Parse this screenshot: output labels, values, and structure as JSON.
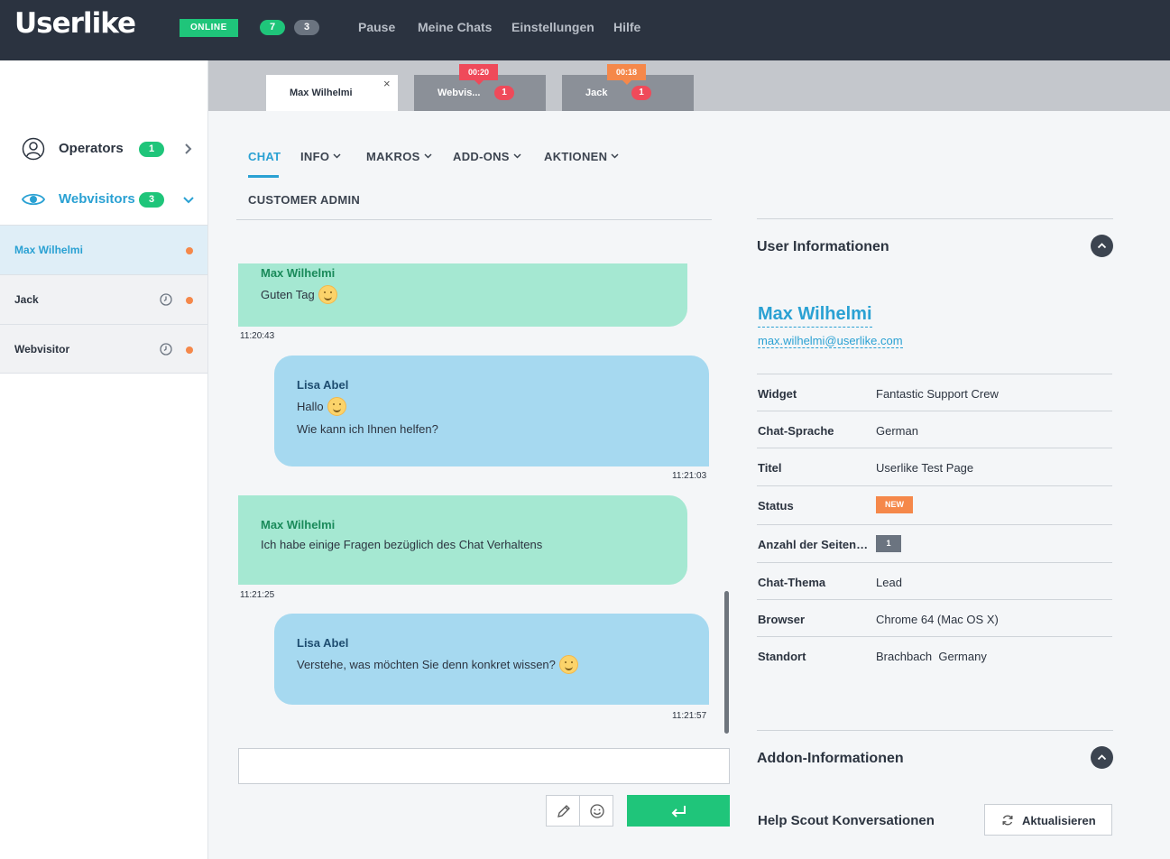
{
  "topbar": {
    "logo": "Userlike",
    "status": "ONLINE",
    "count_active": "7",
    "count_waiting": "3",
    "nav": [
      "Pause",
      "Meine Chats",
      "Einstellungen",
      "Hilfe"
    ]
  },
  "sidebar": {
    "operators": {
      "label": "Operators",
      "count": "1"
    },
    "webvisitors": {
      "label": "Webvisitors",
      "count": "3"
    },
    "visitors": [
      {
        "name": "Max Wilhelmi"
      },
      {
        "name": "Jack"
      },
      {
        "name": "Webvisitor"
      }
    ]
  },
  "tabs": [
    {
      "label": "Max Wilhelmi",
      "close": "×"
    },
    {
      "label": "Webvis...",
      "count": "1",
      "timer": "00:20"
    },
    {
      "label": "Jack",
      "count": "1",
      "timer": "00:18"
    }
  ],
  "chatnav": {
    "chat": "CHAT",
    "info": "INFO",
    "makros": "MAKROS",
    "addons": "ADD-ONS",
    "aktionen": "AKTIONEN",
    "customer_admin": "CUSTOMER ADMIN"
  },
  "messages": [
    {
      "sender": "Max Wilhelmi",
      "text": "Guten Tag",
      "time": "11:20:43"
    },
    {
      "sender": "Lisa Abel",
      "line1": "Hallo",
      "line2": "Wie kann ich Ihnen helfen?",
      "time": "11:21:03"
    },
    {
      "sender": "Max Wilhelmi",
      "text": "Ich habe einige Fragen bezüglich des Chat Verhaltens",
      "time": "11:21:25"
    },
    {
      "sender": "Lisa Abel",
      "text": "Verstehe, was möchten Sie denn konkret wissen?",
      "time": "11:21:57"
    }
  ],
  "user_info": {
    "title": "User Informationen",
    "name": "Max Wilhelmi",
    "email": "max.wilhelmi@userlike.com",
    "rows": [
      {
        "key": "Widget",
        "value": "Fantastic Support Crew"
      },
      {
        "key": "Chat-Sprache",
        "value": "German"
      },
      {
        "key": "Titel",
        "value": "Userlike Test Page"
      },
      {
        "key": "Status",
        "value": "NEW"
      },
      {
        "key": "Anzahl der Seitenaufrufe",
        "value": "1"
      },
      {
        "key": "Chat-Thema",
        "value": "Lead"
      },
      {
        "key": "Browser",
        "value": "Chrome 64 (Mac OS X)"
      },
      {
        "key": "Standort",
        "value": "Brachbach  Germany"
      }
    ]
  },
  "addon_info": {
    "title": "Addon-Informationen",
    "helpscout": "Help Scout Konversationen",
    "refresh": "Aktualisieren"
  },
  "colors": {
    "topbar": "#2b3340",
    "accent_blue": "#2aa1d3",
    "green": "#1fc57a",
    "orange": "#f5884a",
    "red": "#ef4a5a",
    "visitor_bubble": "#a5e8d2",
    "operator_bubble": "#a6d9f0"
  }
}
